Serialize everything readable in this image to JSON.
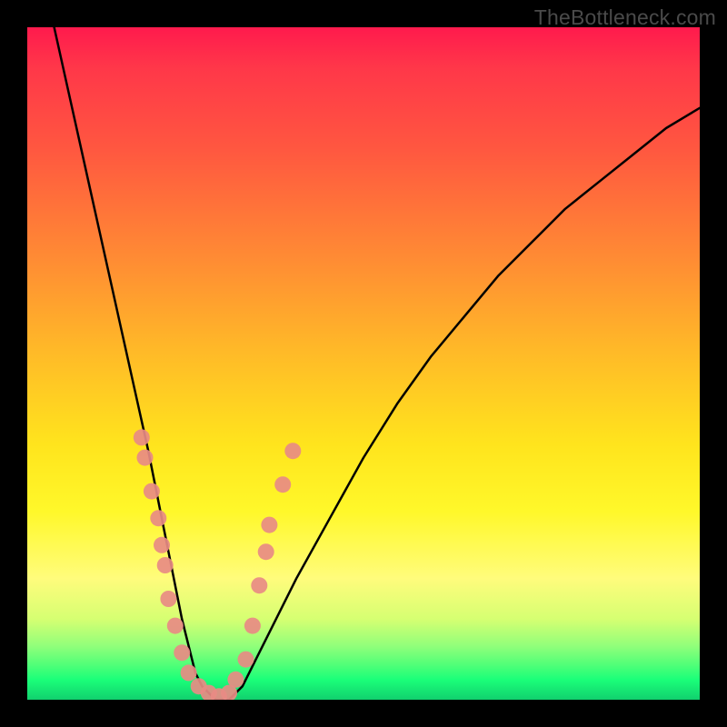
{
  "watermark": "TheBottleneck.com",
  "chart_data": {
    "type": "line",
    "title": "",
    "xlabel": "",
    "ylabel": "",
    "xlim": [
      0,
      100
    ],
    "ylim": [
      0,
      100
    ],
    "background_gradient": {
      "top": "#ff1a4d",
      "mid": "#ffe41d",
      "bottom": "#11d06e"
    },
    "series": [
      {
        "name": "bottleneck-curve",
        "color": "#000000",
        "x": [
          4,
          6,
          8,
          10,
          12,
          14,
          16,
          18,
          20,
          21,
          22,
          23,
          24,
          25,
          26,
          27,
          28,
          30,
          32,
          34,
          37,
          40,
          45,
          50,
          55,
          60,
          65,
          70,
          75,
          80,
          85,
          90,
          95,
          100
        ],
        "y": [
          100,
          91,
          82,
          73,
          64,
          55,
          46,
          37,
          27,
          22,
          17,
          12,
          8,
          4,
          2,
          1,
          0,
          0,
          2,
          6,
          12,
          18,
          27,
          36,
          44,
          51,
          57,
          63,
          68,
          73,
          77,
          81,
          85,
          88
        ]
      }
    ],
    "scatter_markers": {
      "name": "sample-points",
      "color": "#e88b84",
      "radius_px": 9,
      "points": [
        {
          "x": 17.0,
          "y": 39
        },
        {
          "x": 17.5,
          "y": 36
        },
        {
          "x": 18.5,
          "y": 31
        },
        {
          "x": 19.5,
          "y": 27
        },
        {
          "x": 20.0,
          "y": 23
        },
        {
          "x": 20.5,
          "y": 20
        },
        {
          "x": 21.0,
          "y": 15
        },
        {
          "x": 22.0,
          "y": 11
        },
        {
          "x": 23.0,
          "y": 7
        },
        {
          "x": 24.0,
          "y": 4
        },
        {
          "x": 25.5,
          "y": 2
        },
        {
          "x": 27.0,
          "y": 1
        },
        {
          "x": 28.5,
          "y": 0.5
        },
        {
          "x": 30.0,
          "y": 1
        },
        {
          "x": 31.0,
          "y": 3
        },
        {
          "x": 32.5,
          "y": 6
        },
        {
          "x": 33.5,
          "y": 11
        },
        {
          "x": 34.5,
          "y": 17
        },
        {
          "x": 35.5,
          "y": 22
        },
        {
          "x": 36.0,
          "y": 26
        },
        {
          "x": 38.0,
          "y": 32
        },
        {
          "x": 39.5,
          "y": 37
        }
      ]
    }
  }
}
